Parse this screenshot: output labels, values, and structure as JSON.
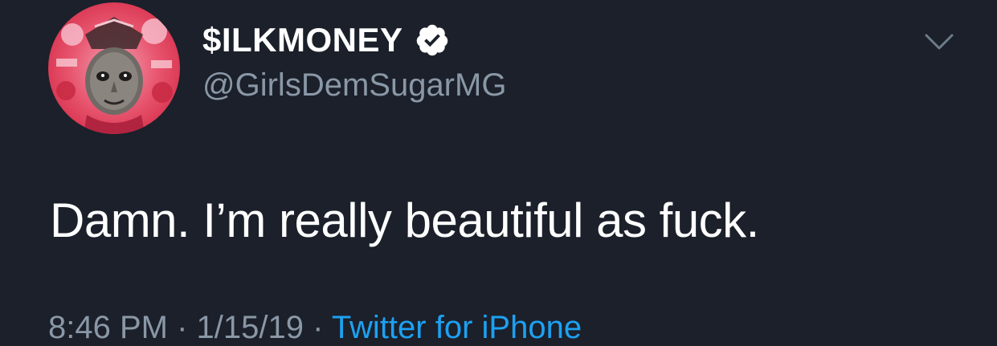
{
  "user": {
    "display_name": "$ILKMONEY",
    "handle": "@GirlsDemSugarMG",
    "verified": true,
    "avatar": "profile-avatar-image"
  },
  "tweet": {
    "text": "Damn. I’m really beautiful as fuck.",
    "time": "8:46 PM",
    "separator": " · ",
    "date": "1/15/19",
    "source": "Twitter for iPhone"
  },
  "icons": {
    "verified": "verified-badge-icon",
    "menu": "chevron-down-icon"
  },
  "colors": {
    "background": "#1b202a",
    "text_primary": "#ffffff",
    "text_secondary": "#8a97a6",
    "link": "#1da1f2"
  }
}
